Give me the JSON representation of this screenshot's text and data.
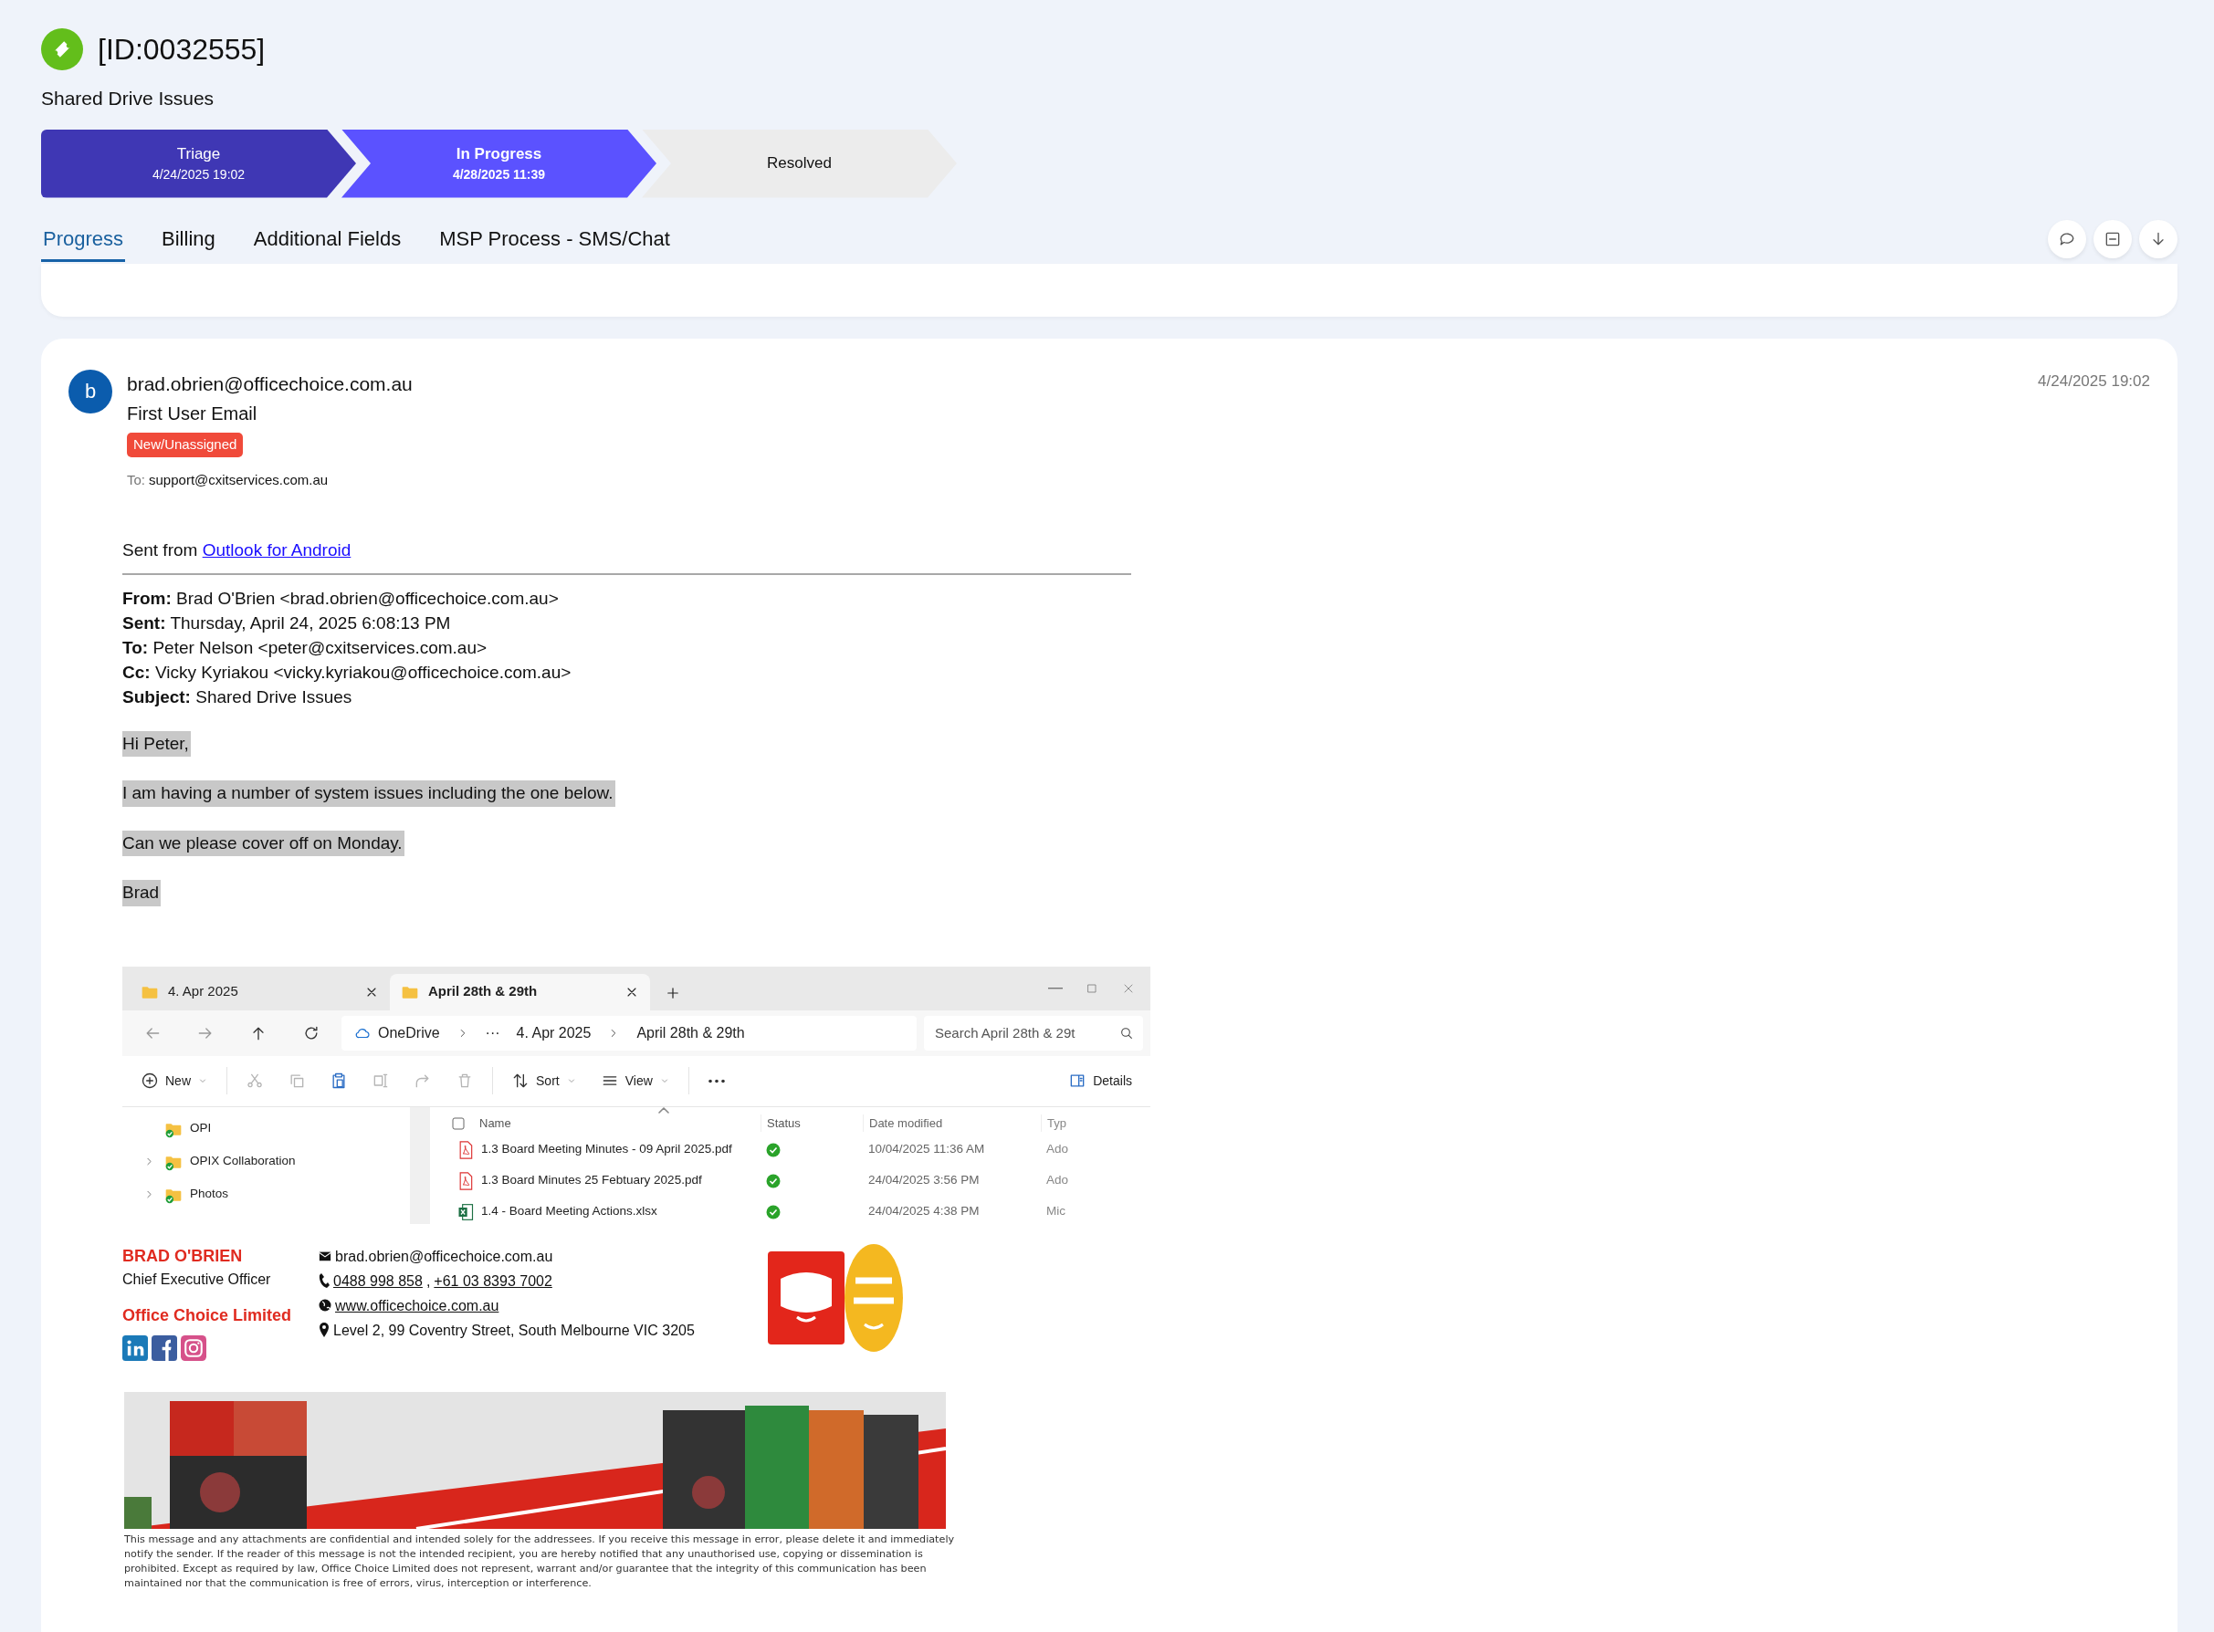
{
  "ticket": {
    "id": "[ID:0032555]",
    "title": "Shared Drive Issues"
  },
  "stages": [
    {
      "name": "Triage",
      "date": "4/24/2025 19:02",
      "kind": "done"
    },
    {
      "name": "In Progress",
      "date": "4/28/2025 11:39",
      "kind": "current"
    },
    {
      "name": "Resolved",
      "kind": "pending"
    }
  ],
  "tabs": [
    {
      "label": "Progress",
      "selected": true
    },
    {
      "label": "Billing",
      "selected": false
    },
    {
      "label": "Additional Fields",
      "selected": false
    },
    {
      "label": "MSP Process - SMS/Chat",
      "selected": false
    }
  ],
  "actions": [
    {
      "kind": "comment"
    },
    {
      "kind": "collapse"
    },
    {
      "kind": "download"
    }
  ],
  "email": {
    "avatar": "b",
    "sender": "brad.obrien@officechoice.com.au",
    "subject": "First User Email",
    "status": "New/Unassigned",
    "to_label": "To:",
    "to": "support@cxitservices.com.au",
    "time": "4/24/2025 19:02",
    "sent_from": "Sent from",
    "sent_from_link": "Outlook for Android",
    "headers": [
      {
        "label": "From:",
        "value": "Brad O'Brien <brad.obrien@officechoice.com.au>"
      },
      {
        "label": "Sent:",
        "value": "Thursday, April 24, 2025 6:08:13 PM"
      },
      {
        "label": "To:",
        "value": "Peter Nelson <peter@cxitservices.com.au>"
      },
      {
        "label": "Cc:",
        "value": "Vicky Kyriakou <vicky.kyriakou@officechoice.com.au>"
      },
      {
        "label": "Subject:",
        "value": "Shared Drive Issues"
      }
    ],
    "paragraphs": [
      {
        "text": "Hi Peter,",
        "highlighted": true
      },
      {
        "text": "I am having a number of system issues including the one below.",
        "highlighted": true
      },
      {
        "text": "Can we please cover off on Monday.",
        "highlighted": true
      },
      {
        "text": "Brad",
        "highlighted": true
      }
    ]
  },
  "explorer": {
    "tabs": [
      {
        "label": "4. Apr 2025",
        "selected": false
      },
      {
        "label": "April 28th & 29th",
        "selected": true
      }
    ],
    "breadcrumb": [
      "OneDrive",
      "···",
      "4. Apr 2025",
      "April 28th & 29th"
    ],
    "search": {
      "placeholder": "Search April 28th & 29t"
    },
    "toolbar": [
      {
        "kind": "new",
        "label": "New",
        "menu": true,
        "disabled": false
      },
      {
        "kind": "cut",
        "disabled": true
      },
      {
        "kind": "copy",
        "disabled": true
      },
      {
        "kind": "paste",
        "disabled": false
      },
      {
        "kind": "rename",
        "disabled": true
      },
      {
        "kind": "share",
        "disabled": true
      },
      {
        "kind": "trash",
        "disabled": true
      },
      {
        "kind": "sort",
        "label": "Sort",
        "menu": true,
        "disabled": false
      },
      {
        "kind": "view",
        "label": "View",
        "menu": true,
        "disabled": false
      },
      {
        "kind": "more",
        "disabled": false
      }
    ],
    "select_all": {
      "checked": false
    },
    "details": "Details",
    "tree": [
      {
        "label": "OPI",
        "expandable": false
      },
      {
        "label": "OPIX Collaboration",
        "expandable": true
      },
      {
        "label": "Photos",
        "expandable": true
      }
    ],
    "columns": [
      "Name",
      "Status",
      "Date modified",
      "Typ"
    ],
    "files": [
      {
        "name": "1.3 Board Meeting Minutes - 09 April 2025.pdf",
        "kind": "pdf",
        "modified": "10/04/2025 11:36 AM",
        "type": "Ado"
      },
      {
        "name": "1.3 Board Minutes 25 Febtuary 2025.pdf",
        "kind": "pdf",
        "modified": "24/04/2025 3:56 PM",
        "type": "Ado"
      },
      {
        "name": "1.4 - Board Meeting Actions.xlsx",
        "kind": "xlsx",
        "modified": "24/04/2025 4:38 PM",
        "type": "Mic"
      }
    ]
  },
  "signature": {
    "name": "BRAD O'BRIEN",
    "role": "Chief Executive Officer",
    "company": "Office Choice Limited",
    "email": "brad.obrien@officechoice.com.au",
    "phones": [
      "0488 998 858",
      "+61 03 8393 7002"
    ],
    "phone_separator": ",",
    "website": "www.officechoice.com.au",
    "address": "Level 2, 99 Coventry Street, South Melbourne VIC 3205"
  },
  "disclaimer": "This message and any attachments are confidential and intended solely for the addressees. If you receive this message in error, please delete it and immediately notify the sender. If the reader of this message is not the intended recipient, you are hereby notified that any unauthorised use, copying or dissemination is prohibited. Except as required by law, Office Choice Limited does not represent, warrant and/or guarantee that the integrity of this communication has been maintained nor that the communication is free of errors, virus, interception or interference."
}
